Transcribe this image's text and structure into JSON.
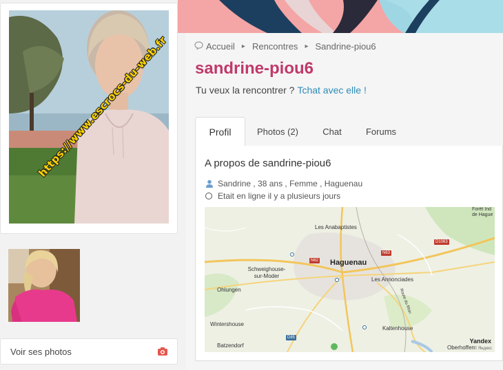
{
  "breadcrumb": {
    "items": [
      "Accueil",
      "Rencontres",
      "Sandrine-piou6"
    ]
  },
  "profile": {
    "title": "sandrine-piou6",
    "prompt": "Tu veux la rencontrer ?",
    "chat_link": "Tchat avec elle !",
    "about_heading": "A propos de sandrine-piou6",
    "details": "Sandrine , 38 ans , Femme , Haguenau",
    "status": "Etait en ligne il y a plusieurs jours"
  },
  "tabs": [
    {
      "label": "Profil",
      "active": true
    },
    {
      "label": "Photos (2)",
      "active": false
    },
    {
      "label": "Chat",
      "active": false
    },
    {
      "label": "Forums",
      "active": false
    }
  ],
  "sidebar": {
    "see_photos": "Voir ses photos",
    "watermark": "https://www.escrocs-du-web.fr"
  },
  "map": {
    "places": [
      "Les Anabaptistes",
      "Haguenau",
      "Schweighouse-sur-Moder",
      "Les Annonciades",
      "Ohlungen",
      "Wintershouse",
      "Kaltenhouse",
      "Batzendorf",
      "Oberhoffen",
      "Forêt Ind de Hague"
    ],
    "roads": [
      "N62",
      "N63",
      "D1063",
      "D85"
    ],
    "road_label": "Route du Rhin",
    "provider": "Yandex",
    "credit": "© Яндекс"
  },
  "colors": {
    "accent": "#c0396a",
    "link": "#2e8bb7",
    "banner": "#f6a9a9",
    "watermark": "#ffd400"
  },
  "icons": [
    "speech-bubble-icon",
    "chevron-right-icon",
    "user-icon",
    "status-ring-icon",
    "camera-icon"
  ]
}
